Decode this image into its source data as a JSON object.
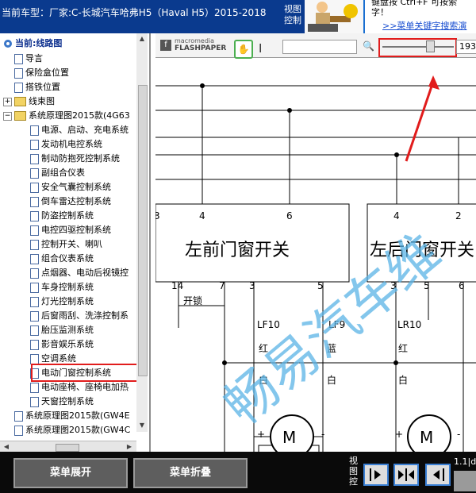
{
  "header": {
    "car_model": "当前车型：厂家:C-长城汽车哈弗H5（Haval H5）2015-2018",
    "view_control": "视图控制"
  },
  "notice": {
    "line1": "键盘按 Ctrl+F 可按索",
    "line2": "字！",
    "link": ">>菜单关键字搜索演"
  },
  "tree": {
    "root": "当前:线路图",
    "items": [
      "导言",
      "保险盒位置",
      "搭铁位置",
      "线束图",
      "系统原理图2015款(4G63",
      "电源、启动、充电系统",
      "发动机电控系统",
      "制动防抱死控制系统",
      "副组合仪表",
      "安全气囊控制系统",
      "倒车雷达控制系统",
      "防盗控制系统",
      "电控四驱控制系统",
      "控制开关、喇叭",
      "组合仪表系统",
      "点烟器、电动后视镜控",
      "车身控制系统",
      "灯光控制系统",
      "后窗雨刮、洗涤控制系",
      "胎压监测系统",
      "影音娱乐系统",
      "空调系统",
      "电动门窗控制系统",
      "电动座椅、座椅电加热",
      "天窗控制系统",
      "系统原理图2015款(GW4E",
      "系统原理图2015款(GW4C"
    ],
    "selected": "电动门窗控制系统"
  },
  "viewer": {
    "logo_top": "macromedia",
    "logo_bottom": "FLASHPAPER",
    "zoom_value": "193",
    "zoom_level": 0.65,
    "watermark": "畅易汽车维",
    "diagram": {
      "left_switch": "左前门窗开关",
      "right_switch": "左后门窗开关",
      "left_top_pins": [
        "3",
        "4",
        "6"
      ],
      "right_top_pins": [
        "4",
        "2"
      ],
      "left_bottom_pins": [
        "14",
        "7",
        "3",
        "5"
      ],
      "right_bottom_pins": [
        "3",
        "5",
        "6"
      ],
      "switch_label": "开锁",
      "wires_left": [
        {
          "name": "LF10",
          "c1": "红",
          "c2": "白"
        },
        {
          "name": "LF9",
          "c1": "蓝",
          "c2": "白"
        }
      ],
      "wires_right": [
        {
          "name": "LR10",
          "c1": "红",
          "c2": "白"
        }
      ],
      "motor": "M",
      "plus": "+",
      "minus": "-"
    }
  },
  "bottom": {
    "expand": "菜单展开",
    "collapse": "菜单折叠",
    "view_control": "视图控",
    "page_info": "1.1|d"
  }
}
